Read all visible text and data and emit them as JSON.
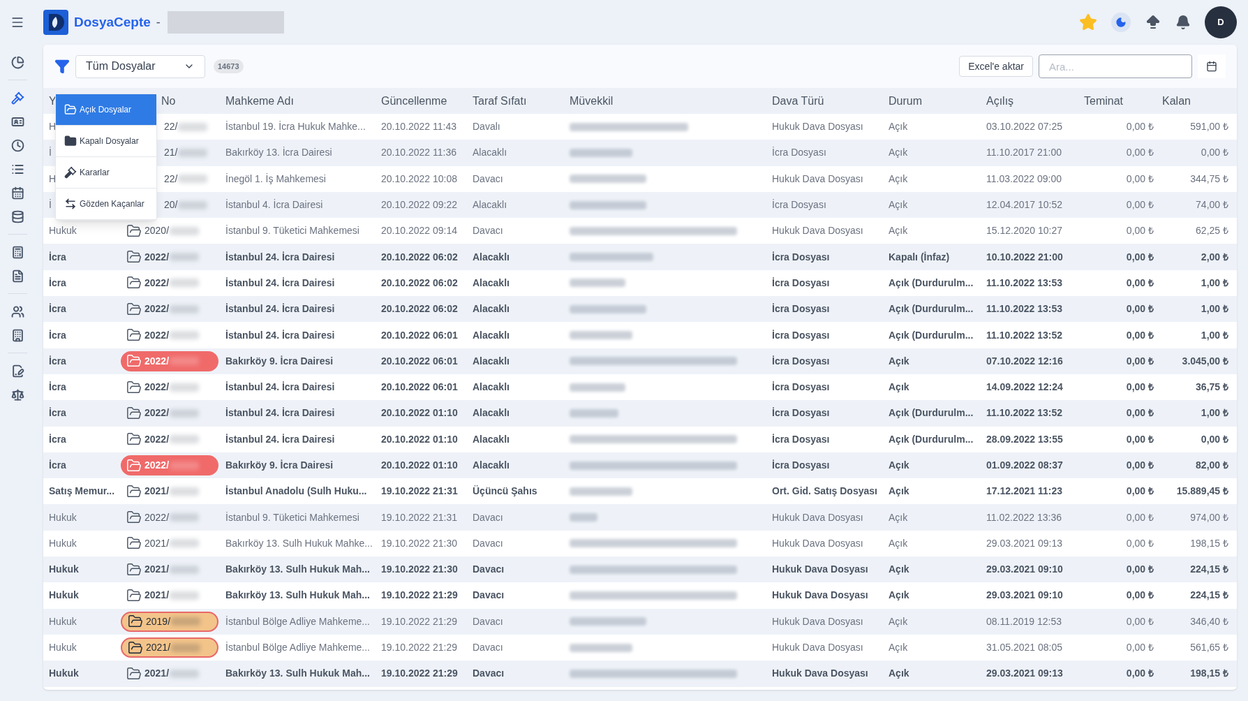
{
  "header": {
    "brand": "DosyaCepte",
    "separator": "-",
    "avatar": "D"
  },
  "sidebar": {
    "items": [
      {
        "selected": false
      },
      {
        "selected": true
      },
      {
        "selected": false
      },
      {
        "selected": false
      },
      {
        "selected": false
      },
      {
        "selected": false
      },
      {
        "selected": false
      },
      {
        "selected": false
      },
      {
        "selected": false
      },
      {
        "selected": false
      },
      {
        "selected": false
      },
      {
        "selected": false
      },
      {
        "selected": false
      }
    ]
  },
  "toolbar": {
    "filter": "Tüm Dosyalar",
    "count": "14673",
    "export": "Excel'e aktar",
    "search": {
      "placeholder": "Ara..."
    }
  },
  "menu": [
    {
      "label": "Açık Dosyalar",
      "selected": true
    },
    {
      "label": "Kapalı Dosyalar",
      "selected": false
    },
    {
      "label": "Kararlar",
      "selected": false
    },
    {
      "label": "Gözden Kaçanlar",
      "selected": false
    }
  ],
  "table": {
    "columns": [
      "Y",
      "No",
      "Mahkeme Adı",
      "Güncellenme",
      "Taraf Sıfatı",
      "Müvekkil",
      "Dava Türü",
      "Durum",
      "Açılış",
      "Teminat",
      "Kalan"
    ],
    "rows": [
      {
        "type": "H",
        "no": "22/",
        "covered": true,
        "bold": false,
        "kind": "plain",
        "court": "İstanbul 19. İcra Hukuk Mahke...",
        "updated": "20.10.2022 11:43",
        "party": "Davalı",
        "case": "Hukuk Dava Dosyası",
        "status": "Açık",
        "opened": "03.10.2022 07:25",
        "guarantee": "0,00 ₺",
        "remaining": "591,00 ₺"
      },
      {
        "type": "İ",
        "no": "21/",
        "covered": true,
        "bold": false,
        "kind": "plain",
        "court": "Bakırköy 13. İcra Dairesi",
        "updated": "20.10.2022 11:36",
        "party": "Alacaklı",
        "case": "İcra Dosyası",
        "status": "Açık",
        "opened": "11.10.2017 21:00",
        "guarantee": "0,00 ₺",
        "remaining": "0,00 ₺"
      },
      {
        "type": "H",
        "no": "22/",
        "covered": true,
        "bold": false,
        "kind": "plain",
        "court": "İnegöl 1. İş Mahkemesi",
        "updated": "20.10.2022 10:08",
        "party": "Davacı",
        "case": "Hukuk Dava Dosyası",
        "status": "Açık",
        "opened": "11.03.2022 09:00",
        "guarantee": "0,00 ₺",
        "remaining": "344,75 ₺"
      },
      {
        "type": "İ",
        "no": "20/",
        "covered": true,
        "bold": false,
        "kind": "plain",
        "court": "İstanbul 4. İcra Dairesi",
        "updated": "20.10.2022 09:22",
        "party": "Alacaklı",
        "case": "İcra Dosyası",
        "status": "Açık",
        "opened": "12.04.2017 10:52",
        "guarantee": "0,00 ₺",
        "remaining": "74,00 ₺"
      },
      {
        "type": "Hukuk",
        "no": "2020/",
        "covered": false,
        "bold": false,
        "kind": "plain",
        "court": "İstanbul 9. Tüketici Mahkemesi",
        "updated": "20.10.2022 09:14",
        "party": "Davacı",
        "case": "Hukuk Dava Dosyası",
        "status": "Açık",
        "opened": "15.12.2020 10:27",
        "guarantee": "0,00 ₺",
        "remaining": "62,25 ₺"
      },
      {
        "type": "İcra",
        "no": "2022/",
        "covered": false,
        "bold": true,
        "kind": "plain",
        "court": "İstanbul 24. İcra Dairesi",
        "updated": "20.10.2022 06:02",
        "party": "Alacaklı",
        "case": "İcra Dosyası",
        "status": "Kapalı (İnfaz)",
        "opened": "10.10.2022 21:00",
        "guarantee": "0,00 ₺",
        "remaining": "2,00 ₺"
      },
      {
        "type": "İcra",
        "no": "2022/",
        "covered": false,
        "bold": true,
        "kind": "plain",
        "court": "İstanbul 24. İcra Dairesi",
        "updated": "20.10.2022 06:02",
        "party": "Alacaklı",
        "case": "İcra Dosyası",
        "status": "Açık (Durdurulm...",
        "opened": "11.10.2022 13:53",
        "guarantee": "0,00 ₺",
        "remaining": "1,00 ₺"
      },
      {
        "type": "İcra",
        "no": "2022/",
        "covered": false,
        "bold": true,
        "kind": "plain",
        "court": "İstanbul 24. İcra Dairesi",
        "updated": "20.10.2022 06:02",
        "party": "Alacaklı",
        "case": "İcra Dosyası",
        "status": "Açık (Durdurulm...",
        "opened": "11.10.2022 13:53",
        "guarantee": "0,00 ₺",
        "remaining": "1,00 ₺"
      },
      {
        "type": "İcra",
        "no": "2022/",
        "covered": false,
        "bold": true,
        "kind": "plain",
        "court": "İstanbul 24. İcra Dairesi",
        "updated": "20.10.2022 06:01",
        "party": "Alacaklı",
        "case": "İcra Dosyası",
        "status": "Açık (Durdurulm...",
        "opened": "11.10.2022 13:52",
        "guarantee": "0,00 ₺",
        "remaining": "1,00 ₺"
      },
      {
        "type": "İcra",
        "no": "2022/",
        "covered": false,
        "bold": true,
        "kind": "alert",
        "court": "Bakırköy 9. İcra Dairesi",
        "updated": "20.10.2022 06:01",
        "party": "Alacaklı",
        "case": "İcra Dosyası",
        "status": "Açık",
        "opened": "07.10.2022 12:16",
        "guarantee": "0,00 ₺",
        "remaining": "3.045,00 ₺"
      },
      {
        "type": "İcra",
        "no": "2022/",
        "covered": false,
        "bold": true,
        "kind": "plain",
        "court": "İstanbul 24. İcra Dairesi",
        "updated": "20.10.2022 06:01",
        "party": "Alacaklı",
        "case": "İcra Dosyası",
        "status": "Açık",
        "opened": "14.09.2022 12:24",
        "guarantee": "0,00 ₺",
        "remaining": "36,75 ₺"
      },
      {
        "type": "İcra",
        "no": "2022/",
        "covered": false,
        "bold": true,
        "kind": "plain",
        "court": "İstanbul 24. İcra Dairesi",
        "updated": "20.10.2022 01:10",
        "party": "Alacaklı",
        "case": "İcra Dosyası",
        "status": "Açık (Durdurulm...",
        "opened": "11.10.2022 13:52",
        "guarantee": "0,00 ₺",
        "remaining": "1,00 ₺"
      },
      {
        "type": "İcra",
        "no": "2022/",
        "covered": false,
        "bold": true,
        "kind": "plain",
        "court": "İstanbul 24. İcra Dairesi",
        "updated": "20.10.2022 01:10",
        "party": "Alacaklı",
        "case": "İcra Dosyası",
        "status": "Açık (Durdurulm...",
        "opened": "28.09.2022 13:55",
        "guarantee": "0,00 ₺",
        "remaining": "0,00 ₺"
      },
      {
        "type": "İcra",
        "no": "2022/",
        "covered": false,
        "bold": true,
        "kind": "alert",
        "court": "Bakırköy 9. İcra Dairesi",
        "updated": "20.10.2022 01:10",
        "party": "Alacaklı",
        "case": "İcra Dosyası",
        "status": "Açık",
        "opened": "01.09.2022 08:37",
        "guarantee": "0,00 ₺",
        "remaining": "82,00 ₺"
      },
      {
        "type": "Satış Memur...",
        "no": "2021/",
        "covered": false,
        "bold": true,
        "kind": "plain",
        "court": "İstanbul Anadolu (Sulh Huku...",
        "updated": "19.10.2022 21:31",
        "party": "Üçüncü Şahıs",
        "case": "Ort. Gid. Satış Dosyası",
        "status": "Açık",
        "opened": "17.12.2021 11:23",
        "guarantee": "0,00 ₺",
        "remaining": "15.889,45 ₺"
      },
      {
        "type": "Hukuk",
        "no": "2022/",
        "covered": false,
        "bold": false,
        "kind": "plain",
        "court": "İstanbul 9. Tüketici Mahkemesi",
        "updated": "19.10.2022 21:31",
        "party": "Davacı",
        "case": "Hukuk Dava Dosyası",
        "status": "Açık",
        "opened": "11.02.2022 13:36",
        "guarantee": "0,00 ₺",
        "remaining": "974,00 ₺"
      },
      {
        "type": "Hukuk",
        "no": "2021/",
        "covered": false,
        "bold": false,
        "kind": "plain",
        "court": "Bakırköy 13. Sulh Hukuk Mahke...",
        "updated": "19.10.2022 21:30",
        "party": "Davacı",
        "case": "Hukuk Dava Dosyası",
        "status": "Açık",
        "opened": "29.03.2021 09:13",
        "guarantee": "0,00 ₺",
        "remaining": "198,15 ₺"
      },
      {
        "type": "Hukuk",
        "no": "2021/",
        "covered": false,
        "bold": true,
        "kind": "plain",
        "court": "Bakırköy 13. Sulh Hukuk Mah...",
        "updated": "19.10.2022 21:30",
        "party": "Davacı",
        "case": "Hukuk Dava Dosyası",
        "status": "Açık",
        "opened": "29.03.2021 09:10",
        "guarantee": "0,00 ₺",
        "remaining": "224,15 ₺"
      },
      {
        "type": "Hukuk",
        "no": "2021/",
        "covered": false,
        "bold": true,
        "kind": "plain",
        "court": "Bakırköy 13. Sulh Hukuk Mah...",
        "updated": "19.10.2022 21:29",
        "party": "Davacı",
        "case": "Hukuk Dava Dosyası",
        "status": "Açık",
        "opened": "29.03.2021 09:10",
        "guarantee": "0,00 ₺",
        "remaining": "224,15 ₺"
      },
      {
        "type": "Hukuk",
        "no": "2019/",
        "covered": false,
        "bold": false,
        "kind": "warning",
        "court": "İstanbul Bölge Adliye Mahkeme...",
        "updated": "19.10.2022 21:29",
        "party": "Davacı",
        "case": "Hukuk Dava Dosyası",
        "status": "Açık",
        "opened": "08.11.2019 12:53",
        "guarantee": "0,00 ₺",
        "remaining": "346,40 ₺"
      },
      {
        "type": "Hukuk",
        "no": "2021/",
        "covered": false,
        "bold": false,
        "kind": "warning",
        "court": "İstanbul Bölge Adliye Mahkeme...",
        "updated": "19.10.2022 21:29",
        "party": "Davacı",
        "case": "Hukuk Dava Dosyası",
        "status": "Açık",
        "opened": "31.05.2021 08:05",
        "guarantee": "0,00 ₺",
        "remaining": "561,65 ₺"
      },
      {
        "type": "Hukuk",
        "no": "2021/",
        "covered": false,
        "bold": true,
        "kind": "plain",
        "court": "Bakırköy 13. Sulh Hukuk Mah...",
        "updated": "19.10.2022 21:29",
        "party": "Davacı",
        "case": "Hukuk Dava Dosyası",
        "status": "Açık",
        "opened": "29.03.2021 09:13",
        "guarantee": "0,00 ₺",
        "remaining": "198,15 ₺"
      }
    ]
  }
}
